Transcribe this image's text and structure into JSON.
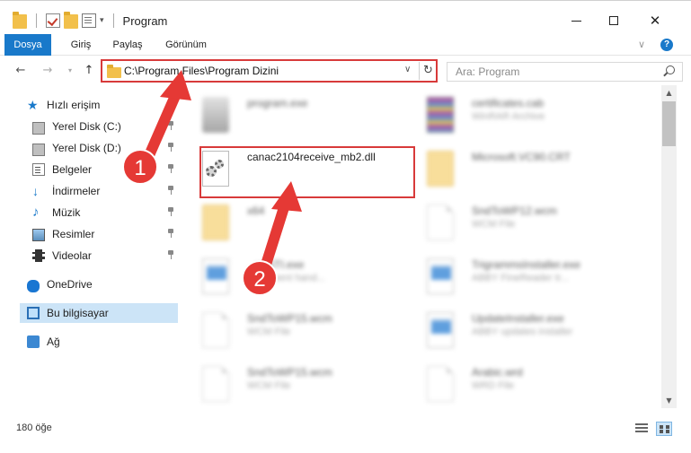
{
  "window": {
    "title": "Program",
    "qat_caret": "▾",
    "min_label": "",
    "close_label": "✕"
  },
  "ribbon": {
    "tabs": [
      "Dosya",
      "Giriş",
      "Paylaş",
      "Görünüm"
    ],
    "chevron": "∨",
    "help": "?"
  },
  "nav": {
    "back": "←",
    "forward": "→",
    "history": "▾",
    "up": "↑",
    "address": "C:\\Program Files\\Program Dizini",
    "address_dropdown": "∨",
    "refresh": "↻",
    "search_placeholder": "Ara: Program"
  },
  "sidebar": {
    "items": [
      {
        "label": "Hızlı erişim",
        "icon": "star-icon"
      },
      {
        "label": "Yerel Disk (C:)",
        "icon": "drive-icon"
      },
      {
        "label": "Yerel Disk (D:)",
        "icon": "drive-icon"
      },
      {
        "label": "Belgeler",
        "icon": "documents-icon"
      },
      {
        "label": "İndirmeler",
        "icon": "downloads-icon"
      },
      {
        "label": "Müzik",
        "icon": "music-icon"
      },
      {
        "label": "Resimler",
        "icon": "pictures-icon"
      },
      {
        "label": "Videolar",
        "icon": "videos-icon"
      },
      {
        "label": "OneDrive",
        "icon": "onedrive-icon"
      },
      {
        "label": "Bu bilgisayar",
        "icon": "this-pc-icon"
      },
      {
        "label": "Ağ",
        "icon": "network-icon"
      }
    ]
  },
  "files": {
    "program_exe": {
      "name": "program.exe",
      "desc": ""
    },
    "certificates": {
      "name": "certificates.cab",
      "desc": "WinRAR Archive"
    },
    "dll": {
      "name": "canac2104receive_mb2.dll",
      "desc": ""
    },
    "vc90": {
      "name": "Microsoft.VC90.CRT",
      "desc": ""
    },
    "x64": {
      "name": "x64",
      "desc": ""
    },
    "sndtowp12": {
      "name": "SndToWP12.wcm",
      "desc": "WCM File"
    },
    "yysti": {
      "name": "...yySTI.exe",
      "desc": "...sti event hand..."
    },
    "trigramms": {
      "name": "TrigrammsInstaller.exe",
      "desc": "ABBY FineReader tr..."
    },
    "sndtowp15a": {
      "name": "SndToWP15.wcm",
      "desc": "WCM File"
    },
    "updateinstaller": {
      "name": "UpdateInstaller.exe",
      "desc": "ABBY updates installer"
    },
    "sndtowp15b": {
      "name": "SndToWP15.wcm",
      "desc": "WCM File"
    },
    "arabic": {
      "name": "Arabic.wrd",
      "desc": "WRD File"
    }
  },
  "scroll": {
    "up": "▲",
    "down": "▼"
  },
  "status": {
    "count": "180 öğe"
  },
  "annotations": {
    "step1": "1",
    "step2": "2"
  },
  "colors": {
    "accent": "#1979ca",
    "highlight": "#d83a3a",
    "selection": "#cce4f7"
  }
}
